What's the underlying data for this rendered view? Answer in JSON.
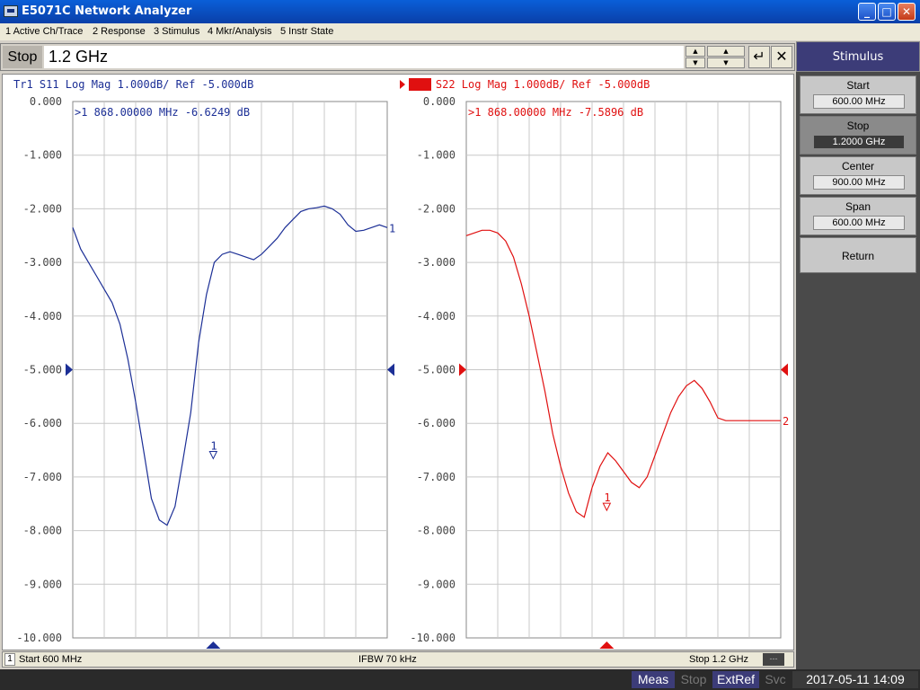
{
  "window": {
    "title": "E5071C Network Analyzer"
  },
  "menu": [
    "1 Active Ch/Trace",
    "2 Response",
    "3 Stimulus",
    "4 Mkr/Analysis",
    "5 Instr State"
  ],
  "entry": {
    "label": "Stop",
    "value": "1.2 GHz"
  },
  "softkeys": {
    "header": "Stimulus",
    "items": [
      {
        "label": "Start",
        "value": "600.00 MHz"
      },
      {
        "label": "Stop",
        "value": "1.2000 GHz"
      },
      {
        "label": "Center",
        "value": "900.00 MHz"
      },
      {
        "label": "Span",
        "value": "600.00 MHz"
      }
    ],
    "return_label": "Return"
  },
  "channel_status": {
    "channel": "1",
    "start": "Start 600 MHz",
    "ifbw": "IFBW 70 kHz",
    "stop": "Stop 1.2 GHz",
    "indicator": "---"
  },
  "status": {
    "meas": "Meas",
    "stop": "Stop",
    "extref": "ExtRef",
    "svc": "Svc",
    "datetime": "2017-05-11 14:09"
  },
  "colors": {
    "trace1": "#1c2f96",
    "trace2": "#e01010",
    "grid": "#c8c8c8",
    "accent": "#3c3c78"
  },
  "chart_data": [
    {
      "type": "line",
      "header": "Tr1 S11 Log Mag 1.000dB/ Ref -5.000dB",
      "marker_text": ">1  868.00000 MHz -6.6249 dB",
      "marker": {
        "id": "1",
        "x": 868,
        "y": -6.6249
      },
      "end_label": "1",
      "ref_value": -5.0,
      "xlim": [
        600,
        1200
      ],
      "ylim": [
        -10,
        0
      ],
      "ytick_labels": [
        "0.000",
        "-1.000",
        "-2.000",
        "-3.000",
        "-4.000",
        "-5.000",
        "-6.000",
        "-7.000",
        "-8.000",
        "-9.000",
        "-10.000"
      ],
      "color": "#1c2f96",
      "series": [
        {
          "name": "S11",
          "x": [
            600,
            615,
            630,
            645,
            660,
            675,
            690,
            705,
            720,
            735,
            750,
            765,
            780,
            795,
            810,
            825,
            840,
            855,
            870,
            885,
            900,
            915,
            930,
            945,
            960,
            975,
            990,
            1005,
            1020,
            1035,
            1050,
            1065,
            1080,
            1095,
            1110,
            1125,
            1140,
            1155,
            1170,
            1185,
            1200
          ],
          "y": [
            -2.35,
            -2.75,
            -3.0,
            -3.25,
            -3.5,
            -3.75,
            -4.15,
            -4.8,
            -5.6,
            -6.5,
            -7.4,
            -7.8,
            -7.9,
            -7.55,
            -6.7,
            -5.8,
            -4.5,
            -3.6,
            -3.0,
            -2.85,
            -2.8,
            -2.85,
            -2.9,
            -2.95,
            -2.85,
            -2.7,
            -2.55,
            -2.35,
            -2.2,
            -2.05,
            -2.0,
            -1.98,
            -1.95,
            -2.0,
            -2.1,
            -2.3,
            -2.42,
            -2.4,
            -2.35,
            -2.3,
            -2.35
          ]
        }
      ]
    },
    {
      "type": "line",
      "header": "Tr2 S22 Log Mag 1.000dB/ Ref -5.000dB",
      "marker_text": ">1  868.00000 MHz -7.5896 dB",
      "marker": {
        "id": "1",
        "x": 868,
        "y": -7.5896
      },
      "end_label": "2",
      "ref_value": -5.0,
      "xlim": [
        600,
        1200
      ],
      "ylim": [
        -10,
        0
      ],
      "ytick_labels": [
        "0.000",
        "-1.000",
        "-2.000",
        "-3.000",
        "-4.000",
        "-5.000",
        "-6.000",
        "-7.000",
        "-8.000",
        "-9.000",
        "-10.000"
      ],
      "color": "#e01010",
      "series": [
        {
          "name": "S22",
          "x": [
            600,
            615,
            630,
            645,
            660,
            675,
            690,
            705,
            720,
            735,
            750,
            765,
            780,
            795,
            810,
            825,
            840,
            855,
            870,
            885,
            900,
            915,
            930,
            945,
            960,
            975,
            990,
            1005,
            1020,
            1035,
            1050,
            1065,
            1080,
            1095,
            1110,
            1125,
            1140,
            1155,
            1170,
            1185,
            1200
          ],
          "y": [
            -2.5,
            -2.45,
            -2.4,
            -2.4,
            -2.45,
            -2.6,
            -2.9,
            -3.4,
            -4.0,
            -4.7,
            -5.4,
            -6.2,
            -6.8,
            -7.3,
            -7.65,
            -7.75,
            -7.2,
            -6.8,
            -6.55,
            -6.7,
            -6.9,
            -7.1,
            -7.2,
            -7.0,
            -6.6,
            -6.2,
            -5.8,
            -5.5,
            -5.3,
            -5.2,
            -5.35,
            -5.6,
            -5.9,
            -5.95,
            -5.95,
            -5.95,
            -5.95,
            -5.95,
            -5.95,
            -5.95,
            -5.95
          ]
        }
      ]
    }
  ]
}
